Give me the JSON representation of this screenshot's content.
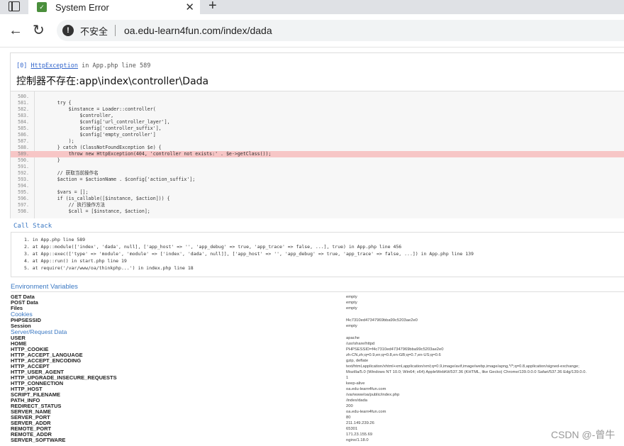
{
  "browser": {
    "tab_title": "System Error",
    "close_glyph": "✕",
    "new_tab_glyph": "+",
    "insecure_label": "不安全",
    "url": "oa.edu-learn4fun.com/index/dada",
    "icons": [
      "sidebar-toggle-icon",
      "site-favicon",
      "close-icon",
      "new-tab-icon",
      "back-icon",
      "reload-icon",
      "warning-icon"
    ]
  },
  "exception": {
    "index": "[0]",
    "class": "HttpException",
    "location": "in App.php line 589",
    "message": "控制器不存在:app\\index\\controller\\Dada"
  },
  "code": [
    {
      "n": "580.",
      "t": ""
    },
    {
      "n": "581.",
      "t": "        try {"
    },
    {
      "n": "582.",
      "t": "            $instance = Loader::controller("
    },
    {
      "n": "583.",
      "t": "                $controller,"
    },
    {
      "n": "584.",
      "t": "                $config['url_controller_layer'],"
    },
    {
      "n": "585.",
      "t": "                $config['controller_suffix'],"
    },
    {
      "n": "586.",
      "t": "                $config['empty_controller']"
    },
    {
      "n": "587.",
      "t": "            );"
    },
    {
      "n": "588.",
      "t": "        } catch (ClassNotFoundException $e) {"
    },
    {
      "n": "589.",
      "t": "            throw new HttpException(404, 'controller not exists:' . $e->getClass());"
    },
    {
      "n": "590.",
      "t": "        }"
    },
    {
      "n": "591.",
      "t": ""
    },
    {
      "n": "592.",
      "t": "        // 获取当前操作名"
    },
    {
      "n": "593.",
      "t": "        $action = $actionName . $config['action_suffix'];"
    },
    {
      "n": "594.",
      "t": ""
    },
    {
      "n": "595.",
      "t": "        $vars = [];"
    },
    {
      "n": "596.",
      "t": "        if (is_callable([$instance, $action])) {"
    },
    {
      "n": "597.",
      "t": "            // 执行操作方法"
    },
    {
      "n": "598.",
      "t": "            $call = [$instance, $action];"
    }
  ],
  "callstack": {
    "title": "Call Stack",
    "items": [
      "1.  in App.php line 589",
      "2.  at App::module(['index', 'dada', null], ['app_host' => '', 'app_debug' => true, 'app_trace' => false, ...], true) in App.php line 456",
      "3.  at App::exec(['type' => 'module', 'module' => ['index', 'dada', null]], ['app_host' => '', 'app_debug' => true, 'app_trace' => false, ...]) in App.php line 139",
      "4.  at App::run() in start.php line 19",
      "5.  at require('/var/www/oa/thinkphp...') in index.php line 18"
    ]
  },
  "environment": {
    "title": "Environment Variables",
    "rows": [
      {
        "k": "GET Data",
        "v": "empty"
      },
      {
        "k": "POST Data",
        "v": "empty"
      },
      {
        "k": "Files",
        "v": "empty"
      },
      {
        "section": "Cookies"
      },
      {
        "k": "PHPSESSID",
        "v": "f4c7310ed47347969bba99c5203ae2e0"
      },
      {
        "k": "Session",
        "v": "empty"
      },
      {
        "section": "Server/Request Data"
      },
      {
        "k": "USER",
        "v": "apache"
      },
      {
        "k": "HOME",
        "v": "/usr/share/httpd"
      },
      {
        "k": "HTTP_COOKIE",
        "v": "PHPSESSID=f4c7310ed47347969bba99c5203ae2e0"
      },
      {
        "k": "HTTP_ACCEPT_LANGUAGE",
        "v": "zh-CN,zh;q=0.9,en;q=0.8,en-GB;q=0.7,en-US;q=0.6"
      },
      {
        "k": "HTTP_ACCEPT_ENCODING",
        "v": "gzip, deflate"
      },
      {
        "k": "HTTP_ACCEPT",
        "v": "text/html,application/xhtml+xml,application/xml;q=0.9,image/avif,image/webp,image/apng,*/*;q=0.8,application/signed-exchange;"
      },
      {
        "k": "HTTP_USER_AGENT",
        "v": "Mozilla/5.0 (Windows NT 10.0; Win64; x64) AppleWebKit/537.36 (KHTML, like Gecko) Chrome/139.0.0.0 Safari/537.36 Edg/139.0.0."
      },
      {
        "k": "HTTP_UPGRADE_INSECURE_REQUESTS",
        "v": "1"
      },
      {
        "k": "HTTP_CONNECTION",
        "v": "keep-alive"
      },
      {
        "k": "HTTP_HOST",
        "v": "oa.edu-learn4fun.com"
      },
      {
        "k": "SCRIPT_FILENAME",
        "v": "/var/www/oa/public/index.php"
      },
      {
        "k": "PATH_INFO",
        "v": "/index/dada"
      },
      {
        "k": "REDIRECT_STATUS",
        "v": "200"
      },
      {
        "k": "SERVER_NAME",
        "v": "oa.edu-learn4fun.com"
      },
      {
        "k": "SERVER_PORT",
        "v": "80"
      },
      {
        "k": "SERVER_ADDR",
        "v": "211.149.239.26"
      },
      {
        "k": "REMOTE_PORT",
        "v": "65301"
      },
      {
        "k": "REMOTE_ADDR",
        "v": "171.23.155.69"
      },
      {
        "k": "SERVER_SOFTWARE",
        "v": "nginx/1.18.0"
      }
    ]
  },
  "watermark": "CSDN @-曾牛"
}
